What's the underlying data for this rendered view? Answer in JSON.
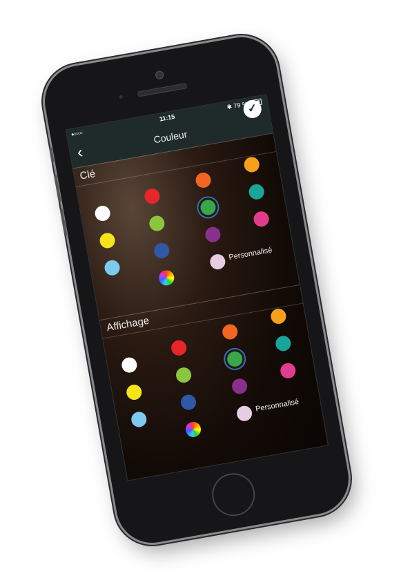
{
  "status_bar": {
    "carrier": "●○○○○",
    "time": "11:15",
    "bluetooth_icon": "bluetooth-icon",
    "battery": "79 %",
    "battery_level": 0.79
  },
  "nav": {
    "title": "Couleur",
    "back_icon": "chevron-left-icon",
    "confirm_icon": "checkmark-icon"
  },
  "sections": [
    {
      "label": "Clé",
      "selected": "green",
      "custom_label": "Personnalisé"
    },
    {
      "label": "Affichage",
      "selected": "green",
      "custom_label": "Personnalisé"
    }
  ],
  "colors": {
    "white": "#ffffff",
    "red": "#e8262a",
    "orange": "#f26522",
    "amber": "#f7a01c",
    "yellow": "#f5e41a",
    "lightgreen": "#8cc63f",
    "green": "#3aa64a",
    "teal": "#1aa59a",
    "lightblue": "#7ccbee",
    "blue": "#2f59a8",
    "purple": "#8b2f8f",
    "pink": "#e23d8c",
    "lavender": "#e6cde2"
  }
}
